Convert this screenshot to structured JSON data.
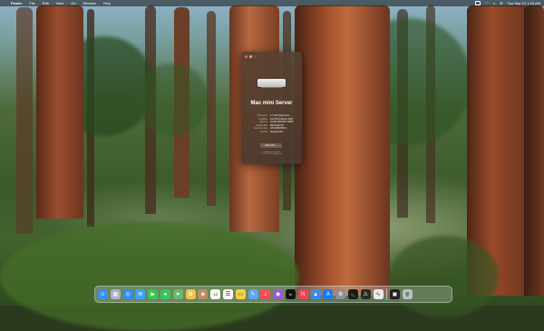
{
  "menubar": {
    "apple_icon": "apple-logo-icon",
    "app_name": "Finder",
    "menus": [
      "File",
      "Edit",
      "View",
      "Go",
      "Window",
      "Help"
    ],
    "clock": "Tue Sep 12  1:23 AM"
  },
  "about_window": {
    "model_name": "Mac mini Server",
    "specs": [
      {
        "key": "Processor",
        "value": "2.7 GHz Quad-Core"
      },
      {
        "key": "Graphics",
        "value": "Intel HD Graphics 4000"
      },
      {
        "key": "Memory",
        "value": "16 GB 1600 MHz DDR3"
      },
      {
        "key": "Startup disk",
        "value": "Macintosh HD"
      },
      {
        "key": "Serial number",
        "value": "C07JQ0FPDWYL"
      },
      {
        "key": "macOS",
        "value": "Sequoia 15.0"
      }
    ],
    "more_info_label": "More Info...",
    "legal_line1": "Regulatory Certification",
    "legal_line2": "™ and © 1983-2024 Apple Inc."
  },
  "dock": {
    "apps": [
      {
        "name": "finder-icon",
        "color": "#3c8ff0",
        "glyph": "☺"
      },
      {
        "name": "launchpad-icon",
        "color": "#a7b3c9",
        "glyph": "▦"
      },
      {
        "name": "safari-icon",
        "color": "#2f8ef5",
        "glyph": "◎"
      },
      {
        "name": "mail-icon",
        "color": "#3aa1ff",
        "glyph": "✉"
      },
      {
        "name": "facetime-icon",
        "color": "#33c759",
        "glyph": "▶"
      },
      {
        "name": "messages-icon",
        "color": "#34c759",
        "glyph": "●"
      },
      {
        "name": "maps-icon",
        "color": "#67b96a",
        "glyph": "➤"
      },
      {
        "name": "photos-icon",
        "color": "#f4c34d",
        "glyph": "✿"
      },
      {
        "name": "contacts-icon",
        "color": "#b89160",
        "glyph": "☻"
      },
      {
        "name": "calendar-icon",
        "color": "#f4f4f4",
        "glyph": "12"
      },
      {
        "name": "reminders-icon",
        "color": "#f7f7f7",
        "glyph": "☰"
      },
      {
        "name": "notes-icon",
        "color": "#f6d047",
        "glyph": "▭"
      },
      {
        "name": "freeform-icon",
        "color": "#5ca7f5",
        "glyph": "✎"
      },
      {
        "name": "music-icon",
        "color": "#fa4a5e",
        "glyph": "♪"
      },
      {
        "name": "podcasts-icon",
        "color": "#9b59d6",
        "glyph": "◉"
      },
      {
        "name": "tv-icon",
        "color": "#111111",
        "glyph": "tv"
      },
      {
        "name": "news-icon",
        "color": "#f34153",
        "glyph": "N"
      },
      {
        "name": "keynote-icon",
        "color": "#3f8be8",
        "glyph": "▲"
      },
      {
        "name": "app-store-icon",
        "color": "#1a7cf1",
        "glyph": "A"
      },
      {
        "name": "system-settings-icon",
        "color": "#8e8e93",
        "glyph": "⚙"
      },
      {
        "name": "terminal-icon",
        "color": "#1b1b1b",
        "glyph": ">_"
      },
      {
        "name": "console-icon",
        "color": "#2a2a2a",
        "glyph": "⚠"
      },
      {
        "name": "activity-monitor-icon",
        "color": "#e9e9e9",
        "glyph": "∿"
      }
    ],
    "recents": [
      {
        "name": "screen-sharing-icon",
        "color": "#1f1f1f",
        "glyph": "▣"
      }
    ],
    "trash": {
      "name": "trash-icon",
      "color": "#b9bec4",
      "glyph": "🗑"
    }
  }
}
